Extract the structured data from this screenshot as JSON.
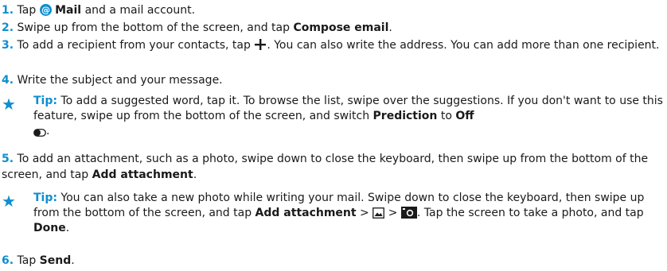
{
  "steps": {
    "s1": {
      "num": "1.",
      "pre": "Tap",
      "mail": "Mail",
      "post": "and a mail account."
    },
    "s2": {
      "num": "2.",
      "pre": "Swipe up from the bottom of the screen, and tap",
      "bold": "Compose email",
      "post": "."
    },
    "s3": {
      "num": "3.",
      "pre": "To add a recipient from your contacts, tap",
      "post": ". You can also write the address. You can add more than one recipient."
    },
    "s4": {
      "num": "4.",
      "text": "Write the subject and your message."
    },
    "s5": {
      "num": "5.",
      "pre": "To add an attachment, such as a photo, swipe down to close the keyboard, then swipe up from the bottom of the screen, and tap",
      "bold": "Add attachment",
      "post": "."
    },
    "s6": {
      "num": "6.",
      "pre": "Tap",
      "bold": "Send",
      "post": "."
    }
  },
  "tip1": {
    "label": "Tip:",
    "text": "To add a suggested word, tap it. To browse the list, swipe over the suggestions. If you don't want to use this feature, swipe up from the bottom of the screen, and switch",
    "b1": "Prediction",
    "mid": "to",
    "b2": "Off"
  },
  "tip2": {
    "label": "Tip:",
    "text": "You can also take a new photo while writing your mail. Swipe down to close the keyboard, then swipe up from the bottom of the screen, and tap",
    "b1": "Add attachment",
    "sep1": ">",
    "sep2": ">",
    "post1": ". Tap the screen to take a photo, and tap",
    "b2": "Done",
    "post2": "."
  },
  "icons": {
    "mail": "at-icon",
    "add": "plus-icon",
    "star": "star-icon",
    "toggle": "toggle-off-icon",
    "photos": "photos-icon",
    "camera": "camera-icon"
  },
  "colors": {
    "accent": "#0d8fd0"
  }
}
